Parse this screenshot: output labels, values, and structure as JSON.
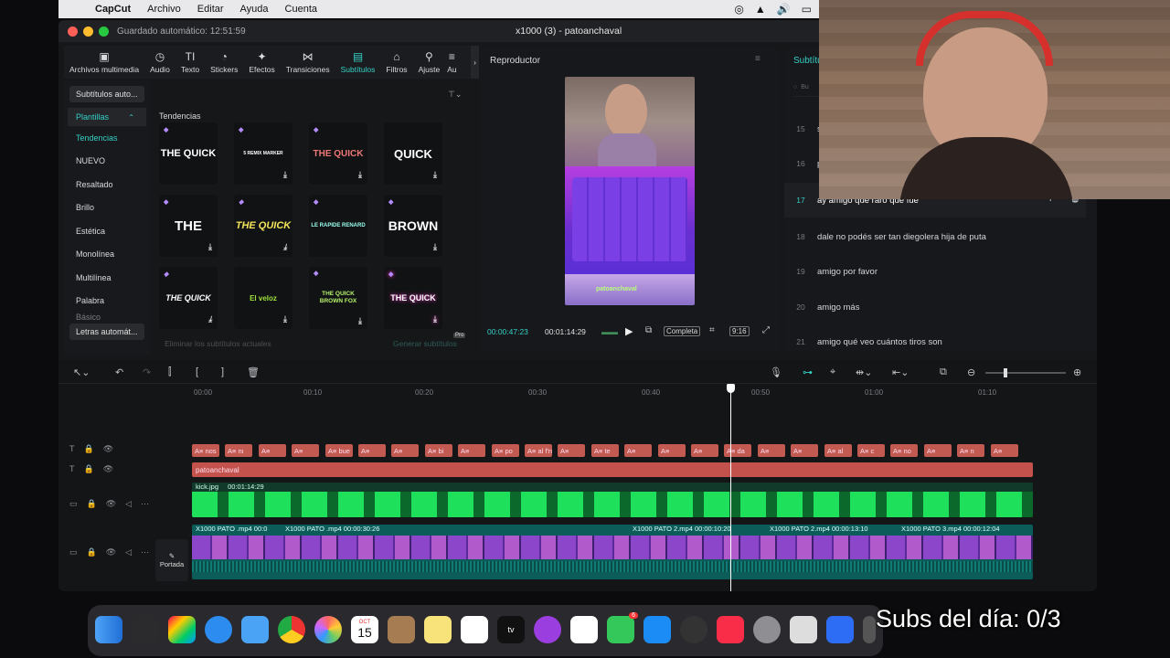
{
  "menubar": {
    "app_name": "CapCut",
    "items": [
      "Archivo",
      "Editar",
      "Ayuda",
      "Cuenta"
    ]
  },
  "window": {
    "autosave": "Guardado automático: 12:51:59",
    "title": "x1000 (3) - patoanchaval"
  },
  "toolbar": {
    "items": [
      {
        "label": "Archivos multimedia",
        "icon": "media-icon"
      },
      {
        "label": "Audio",
        "icon": "audio-icon"
      },
      {
        "label": "Texto",
        "icon": "text-icon"
      },
      {
        "label": "Stickers",
        "icon": "sticker-icon"
      },
      {
        "label": "Efectos",
        "icon": "effects-icon"
      },
      {
        "label": "Transiciones",
        "icon": "transitions-icon"
      },
      {
        "label": "Subtítulos",
        "icon": "subtitles-icon",
        "active": true
      },
      {
        "label": "Filtros",
        "icon": "filters-icon"
      },
      {
        "label": "Ajuste",
        "icon": "adjust-icon"
      },
      {
        "label": "Au",
        "icon": "more-icon"
      }
    ]
  },
  "left_menu": {
    "auto_button": "Subtítulos auto...",
    "section": "Plantillas",
    "items": [
      "Tendencias",
      "NUEVO",
      "Resaltado",
      "Brillo",
      "Estética",
      "Monolínea",
      "Multilínea",
      "Palabra",
      "Básico"
    ],
    "bottom_button": "Letras automát..."
  },
  "templates": {
    "section_title": "Tendencias",
    "cards": [
      {
        "text": "THE QUICK"
      },
      {
        "text": "5 REMIX MARKER"
      },
      {
        "text": "THE QUICK"
      },
      {
        "text": "QUICK"
      },
      {
        "text": "THE"
      },
      {
        "text": "THE QUICK"
      },
      {
        "text": "LE RAPIDE RENARD"
      },
      {
        "text": "BROWN"
      },
      {
        "text": "THE QUICK"
      },
      {
        "text": "El veloz"
      },
      {
        "text": "THE QUICK BROWN FOX"
      },
      {
        "text": "THE QUICK"
      }
    ],
    "footer_left": "Eliminar los subtítulos actuales",
    "footer_right": "Generar subtítulos",
    "pro_badge": "Pro"
  },
  "player": {
    "title": "Reproductor",
    "current_time": "00:00:47:23",
    "total_time": "00:01:14:29",
    "mode": "Completa",
    "ratio": "9:16",
    "overlay_text": "patoanchaval"
  },
  "subtitles_panel": {
    "title": "Subtítu",
    "search_placeholder": "Bu",
    "rows": [
      {
        "n": "15",
        "text": "s"
      },
      {
        "n": "16",
        "text": "p"
      },
      {
        "n": "17",
        "text": "ay amigo qué raro que fue"
      },
      {
        "n": "18",
        "text": "dale no podés ser tan diegolera hija de puta"
      },
      {
        "n": "19",
        "text": "amigo por favor"
      },
      {
        "n": "20",
        "text": "amigo más"
      },
      {
        "n": "21",
        "text": "amigo qué veo cuántos tiros son"
      }
    ]
  },
  "timeline": {
    "ruler": [
      "00:00",
      "00:10",
      "00:20",
      "00:30",
      "00:40",
      "00:50",
      "01:00",
      "01:10"
    ],
    "text_track_label": "patoanchaval",
    "image_clip": {
      "name": "kick.jpg",
      "duration": "00:01:14:29"
    },
    "video_clips": [
      {
        "label": "X1000 PATO .mp4   00:0"
      },
      {
        "label": "X1000 PATO .mp4   00:00:30:26"
      },
      {
        "label": "X1000 PATO 2.mp4   00:00:10:20"
      },
      {
        "label": "X1000 PATO 2.mp4   00:00:13:10"
      },
      {
        "label": "X1000 PATO 3.mp4   00:00:12:04"
      }
    ],
    "cover_label": "Portada",
    "sub_clips": [
      "nos",
      "nı",
      "",
      "",
      "bue",
      "",
      "",
      "bi",
      "",
      "po",
      "al f'n",
      "",
      "te",
      "",
      "",
      "",
      "da",
      "",
      "",
      "al",
      "c",
      "no",
      "",
      "n",
      ""
    ],
    "playhead_progress": 0.64
  },
  "dock": {
    "calendar_month": "OCT",
    "calendar_day": "15",
    "badge_count": "6"
  },
  "overlay_caption": "Subs del día: 0/3"
}
